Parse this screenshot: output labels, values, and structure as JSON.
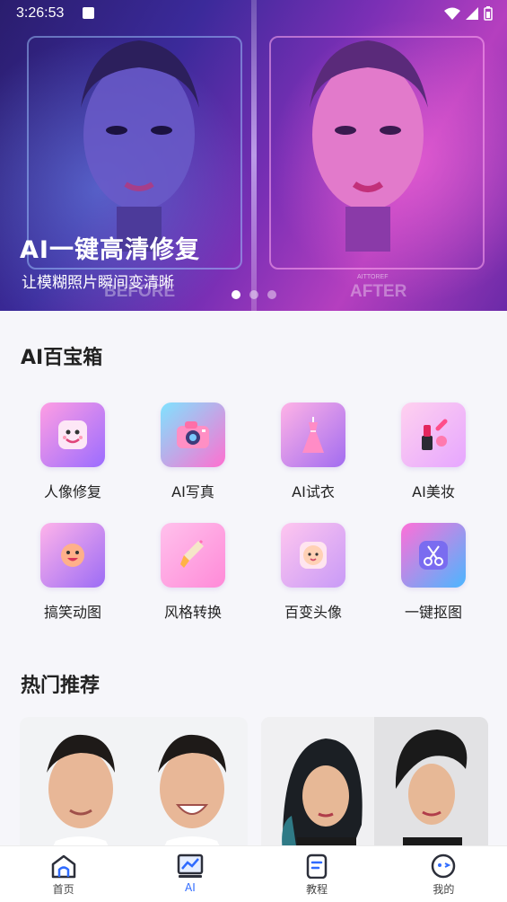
{
  "status_bar": {
    "time": "3:26:53"
  },
  "banner": {
    "title": "AI一键高清修复",
    "subtitle": "让模糊照片瞬间变清晰",
    "before_label": "BEFORE",
    "after_label": "AFTER",
    "after_small": "AITTOREF",
    "page_indicator": {
      "count": 3,
      "active": 1
    }
  },
  "toolbox": {
    "title": "AI百宝箱",
    "items": [
      {
        "label": "人像修复",
        "icon": "face-repair-icon"
      },
      {
        "label": "AI写真",
        "icon": "camera-icon"
      },
      {
        "label": "AI试衣",
        "icon": "dress-icon"
      },
      {
        "label": "AI美妆",
        "icon": "makeup-icon"
      },
      {
        "label": "搞笑动图",
        "icon": "emoji-icon"
      },
      {
        "label": "风格转换",
        "icon": "brush-icon"
      },
      {
        "label": "百变头像",
        "icon": "baby-avatar-icon"
      },
      {
        "label": "一键抠图",
        "icon": "scissors-icon"
      }
    ]
  },
  "recommended": {
    "title": "热门推荐"
  },
  "bottom_nav": {
    "items": [
      {
        "label": "首页",
        "icon": "home-icon"
      },
      {
        "label": "AI",
        "icon": "ai-chart-icon",
        "active": true
      },
      {
        "label": "教程",
        "icon": "tutorial-icon"
      },
      {
        "label": "我的",
        "icon": "profile-icon"
      }
    ]
  },
  "colors": {
    "accent": "#2f6bff",
    "icon_gradient_start": "#ff8ad8",
    "icon_gradient_end": "#8a5cf6"
  }
}
